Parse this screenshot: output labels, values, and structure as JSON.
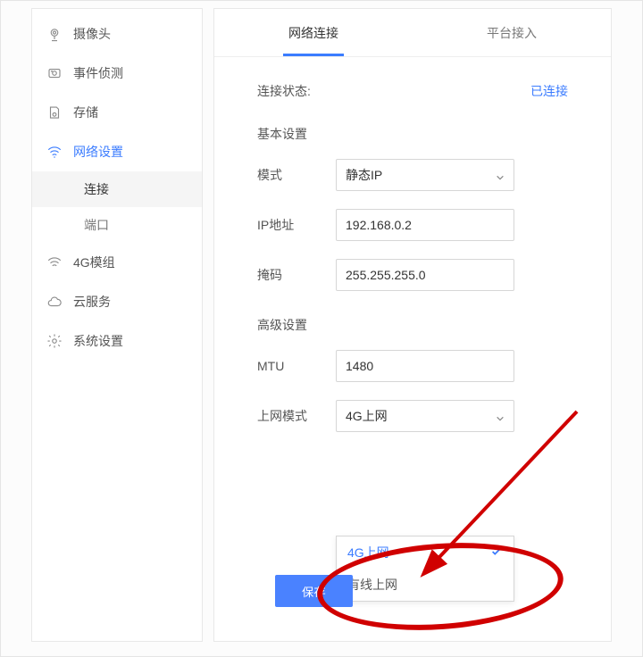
{
  "sidebar": {
    "items": [
      {
        "label": "摄像头",
        "icon": "camera"
      },
      {
        "label": "事件侦测",
        "icon": "detect"
      },
      {
        "label": "存储",
        "icon": "storage"
      },
      {
        "label": "网络设置",
        "icon": "wifi",
        "active": true,
        "subs": [
          {
            "label": "连接",
            "selected": true
          },
          {
            "label": "端口",
            "selected": false
          }
        ]
      },
      {
        "label": "4G模组",
        "icon": "wifi2"
      },
      {
        "label": "云服务",
        "icon": "cloud"
      },
      {
        "label": "系统设置",
        "icon": "gear"
      }
    ]
  },
  "tabs": [
    {
      "label": "网络连接",
      "active": true
    },
    {
      "label": "平台接入",
      "active": false
    }
  ],
  "status": {
    "label": "连接状态:",
    "value": "已连接"
  },
  "basic": {
    "title": "基本设置",
    "mode_label": "模式",
    "mode_value": "静态IP",
    "ip_label": "IP地址",
    "ip_value": "192.168.0.2",
    "mask_label": "掩码",
    "mask_value": "255.255.255.0"
  },
  "advanced": {
    "title": "高级设置",
    "mtu_label": "MTU",
    "mtu_value": "1480",
    "netmode_label": "上网模式",
    "netmode_value": "4G上网",
    "netmode_options": [
      {
        "label": "4G上网",
        "selected": true
      },
      {
        "label": "有线上网",
        "selected": false
      }
    ]
  },
  "save_label": "保存",
  "colors": {
    "accent": "#3b7cff",
    "annotation": "#d00000"
  }
}
